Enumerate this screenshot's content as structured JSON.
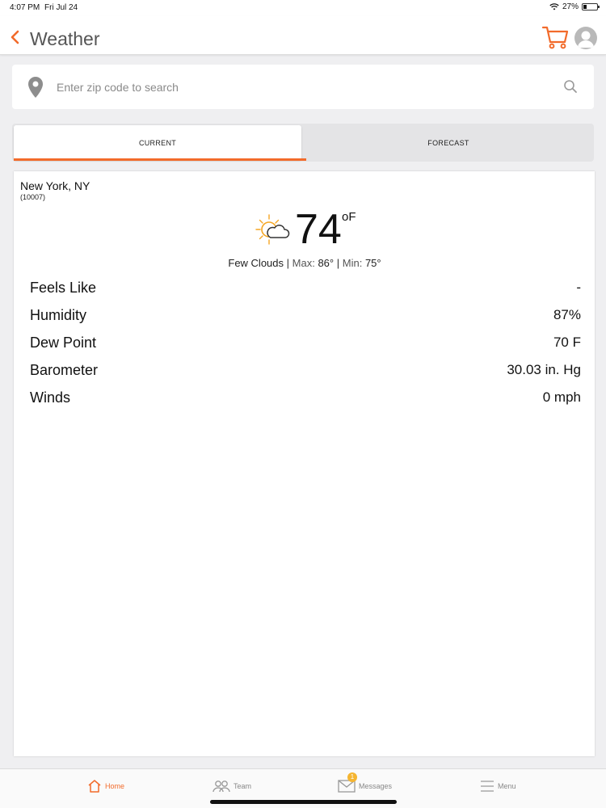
{
  "status_bar": {
    "time": "4:07 PM",
    "date": "Fri Jul 24",
    "battery": "27%",
    "battery_level": 0.27
  },
  "nav": {
    "title": "Weather",
    "back_icon": "chevron-left-icon",
    "cart_icon": "cart-icon",
    "avatar_icon": "user-avatar-icon"
  },
  "search": {
    "placeholder": "Enter zip code to search",
    "value": "",
    "location_icon": "map-pin-icon",
    "search_icon": "search-icon"
  },
  "tabs": [
    {
      "label": "CURRENT",
      "active": true
    },
    {
      "label": "FORECAST",
      "active": false
    }
  ],
  "weather": {
    "city": "New York, NY",
    "zip": "(10007)",
    "icon": "partly-cloudy-icon",
    "temperature": "74",
    "unit": "oF",
    "condition": "Few Clouds",
    "max_label": "Max:",
    "max_value": "86°",
    "min_label": "Min:",
    "min_value": "75°",
    "details": [
      {
        "label": "Feels Like",
        "value": "-"
      },
      {
        "label": "Humidity",
        "value": "87%"
      },
      {
        "label": "Dew Point",
        "value": "70 F"
      },
      {
        "label": "Barometer",
        "value": "30.03 in. Hg"
      },
      {
        "label": "Winds",
        "value": "0 mph"
      }
    ]
  },
  "bottom_nav": [
    {
      "label": "Home",
      "icon": "home-icon",
      "active": true
    },
    {
      "label": "Team",
      "icon": "team-icon",
      "active": false
    },
    {
      "label": "Messages",
      "icon": "envelope-icon",
      "badge": "1",
      "active": false
    },
    {
      "label": "Menu",
      "icon": "hamburger-menu-icon",
      "active": false
    }
  ],
  "colors": {
    "accent": "#f26b2b",
    "background": "#efeff1",
    "badge": "#f5b531"
  }
}
